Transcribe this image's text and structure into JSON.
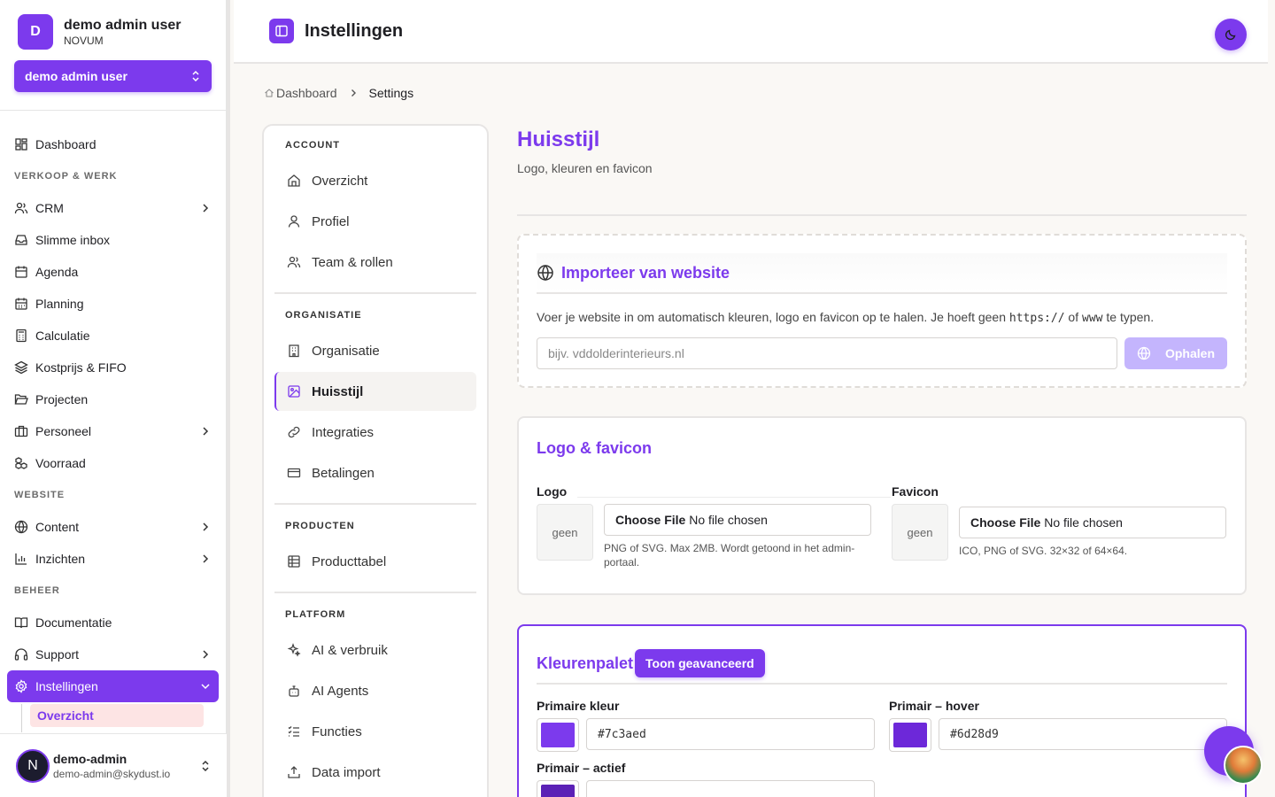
{
  "sidebar": {
    "user_initial": "D",
    "user_name": "demo admin user",
    "org": "NOVUM",
    "switcher_label": "demo admin user",
    "top_item": "Dashboard",
    "groups": [
      {
        "label": "VERKOOP & WERK"
      },
      {
        "label": "WEBSITE"
      },
      {
        "label": "BEHEER"
      }
    ],
    "items": {
      "crm": "CRM",
      "inbox": "Slimme inbox",
      "agenda": "Agenda",
      "planning": "Planning",
      "calculatie": "Calculatie",
      "kostprijs": "Kostprijs & FIFO",
      "projecten": "Projecten",
      "personeel": "Personeel",
      "voorraad": "Voorraad",
      "content": "Content",
      "inzichten": "Inzichten",
      "documentatie": "Documentatie",
      "support": "Support",
      "instellingen": "Instellingen",
      "overzicht": "Overzicht"
    },
    "footer": {
      "initial": "N",
      "name": "demo-admin",
      "email": "demo-admin@skydust.io"
    }
  },
  "topbar": {
    "title": "Instellingen"
  },
  "breadcrumb": {
    "home": "Dashboard",
    "current": "Settings"
  },
  "settings_nav": {
    "account": "ACCOUNT",
    "overzicht": "Overzicht",
    "profiel": "Profiel",
    "team": "Team & rollen",
    "organisatie_group": "ORGANISATIE",
    "organisatie": "Organisatie",
    "huisstijl": "Huisstijl",
    "integraties": "Integraties",
    "betalingen": "Betalingen",
    "producten_group": "PRODUCTEN",
    "producttabel": "Producttabel",
    "platform_group": "PLATFORM",
    "ai": "AI & verbruik",
    "agents": "AI Agents",
    "functies": "Functies",
    "import": "Data import"
  },
  "main": {
    "title": "Huisstijl",
    "subtitle": "Logo, kleuren en favicon",
    "import": {
      "title": "Importeer van website",
      "text_before": "Voer je website in om automatisch kleuren, logo en favicon op te halen. Je hoeft geen ",
      "code1": "https://",
      "text_mid": " of ",
      "code2": "www",
      "text_after": " te typen.",
      "placeholder": "bijv. vddolderinterieurs.nl",
      "button": "Ophalen"
    },
    "logo": {
      "title": "Logo & favicon",
      "logo_label": "Logo",
      "logo_preview": "geen",
      "logo_choose": "Choose File",
      "logo_none": "No file chosen",
      "logo_help": "PNG of SVG. Max 2MB. Wordt getoond in het admin-portaal.",
      "favicon_label": "Favicon",
      "favicon_preview": "geen",
      "favicon_choose": "Choose File",
      "favicon_none": "No file chosen",
      "favicon_help": "ICO, PNG of SVG. 32×32 of 64×64."
    },
    "palette": {
      "title": "Kleurenpalet",
      "advanced_button": "Toon geavanceerd",
      "primary_label": "Primaire kleur",
      "primary_value": "#7c3aed",
      "hover_label": "Primair – hover",
      "hover_value": "#6d28d9",
      "active_label": "Primair – actief",
      "active_color": "#5b21b6"
    }
  },
  "colors": {
    "accent": "#7c3aed"
  }
}
